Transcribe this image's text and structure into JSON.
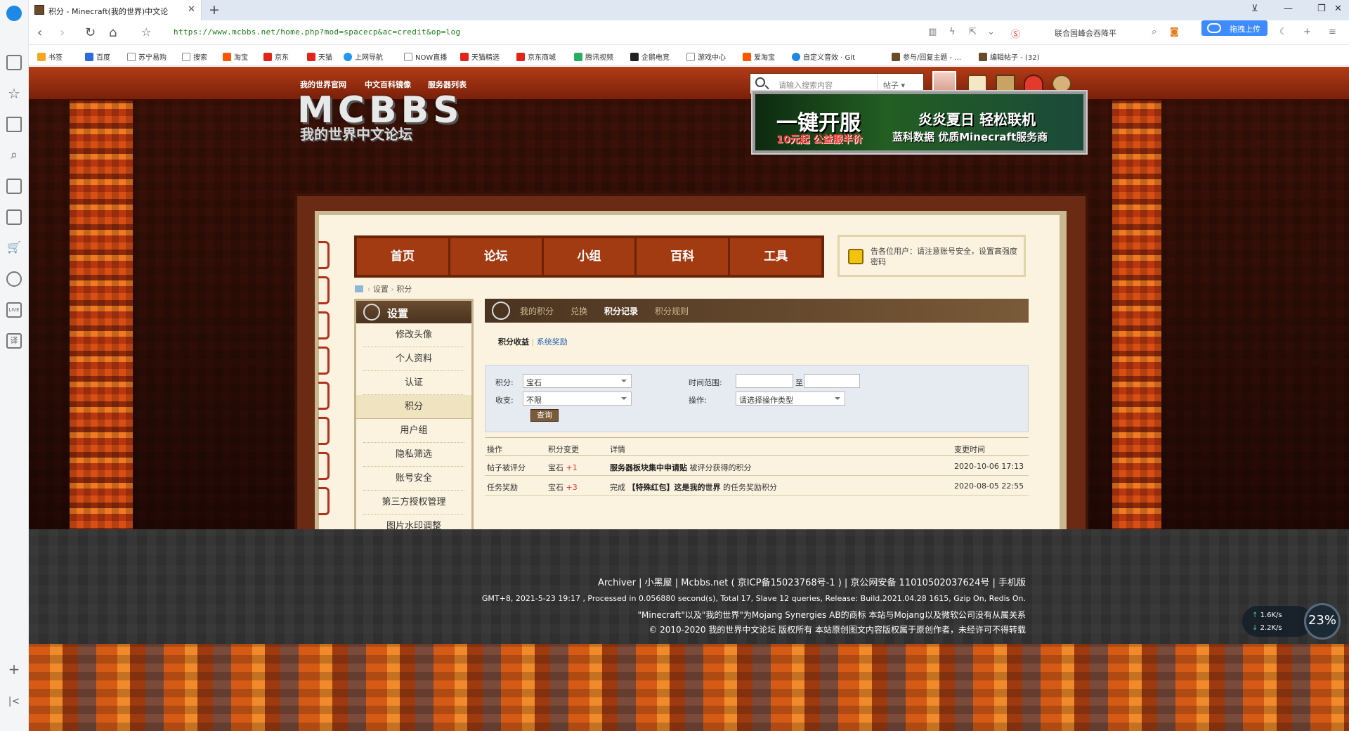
{
  "browser": {
    "tab_title": "积分 - Minecraft(我的世界)中文论",
    "url": "https://www.mcbbs.net/home.php?mod=spacecp&ac=credit&op=log",
    "search_hint": "联合国峰会吞降平",
    "upload_label": "拖拽上传",
    "bookmarks": [
      "书签",
      "百度",
      "苏宁易购",
      "搜索",
      "淘宝",
      "京东",
      "天猫",
      "上网导航",
      "NOW直播",
      "天猫精选",
      "京东商城",
      "腾讯视频",
      "企鹅电竞",
      "游戏中心",
      "爱淘宝",
      "自定义音效 · Git",
      "参与/回复主题 - ...",
      "编辑帖子 - (32)"
    ]
  },
  "site": {
    "top_links": [
      "我的世界官网",
      "中文百科镜像",
      "服务器列表"
    ],
    "search_placeholder": "请输入搜索内容",
    "search_type": "帖子",
    "logo_line1": "MCBBS",
    "logo_line2": "我的世界中文论坛",
    "banner": {
      "big": "一键开服",
      "promo": "10元起 公益服半价",
      "slogan": "炎炎夏日 轻松联机",
      "vendor": "蓝科数据 优质Minecraft服务商"
    },
    "nav": [
      "首页",
      "论坛",
      "小组",
      "百科",
      "工具"
    ],
    "notice": "告各位用户：请注意账号安全，设置高强度密码",
    "breadcrumb": [
      "设置",
      "积分"
    ]
  },
  "sidebar": {
    "title": "设置",
    "items": [
      "修改头像",
      "个人资料",
      "认证",
      "积分",
      "用户组",
      "隐私筛选",
      "账号安全",
      "第三方授权管理",
      "图片水印调整"
    ],
    "active": "积分"
  },
  "content": {
    "tabs": [
      "我的积分",
      "兑换",
      "积分记录",
      "积分规则"
    ],
    "active_tab": "积分记录",
    "subtabs": [
      "积分收益",
      "系统奖励"
    ],
    "filter": {
      "credit_label": "积分:",
      "credit_value": "宝石",
      "inout_label": "收支:",
      "inout_value": "不限",
      "time_label": "时间范围:",
      "to_label": "至",
      "op_label": "操作:",
      "op_value": "请选择操作类型",
      "query_button": "查询"
    },
    "table": {
      "headers": [
        "操作",
        "积分变更",
        "详情",
        "变更时间"
      ],
      "rows": [
        {
          "op": "帖子被评分",
          "credit": "宝石",
          "delta": "+1",
          "detail_bold": "服务器板块集中申请贴",
          "detail_rest": " 被评分获得的积分",
          "time": "2020-10-06 17:13"
        },
        {
          "op": "任务奖励",
          "credit": "宝石",
          "delta": "+3",
          "detail_pre": "完成 ",
          "detail_bold": "【特殊红包】这是我的世界",
          "detail_rest": " 的任务奖励积分",
          "time": "2020-08-05 22:55"
        }
      ]
    }
  },
  "footer": {
    "line1": "Archiver | 小黑屋 | Mcbbs.net ( 京ICP备15023768号-1 ) | 京公网安备 11010502037624号 | 手机版",
    "line2": "GMT+8, 2021-5-23 19:17 , Processed in 0.056880 second(s), Total 17, Slave 12 queries, Release: Build.2021.04.28 1615, Gzip On, Redis On.",
    "line3": "\"Minecraft\"以及\"我的世界\"为Mojang Synergies AB的商标 本站与Mojang以及微软公司没有从属关系",
    "line4": "© 2010-2020 我的世界中文论坛 版权所有 本站原创图文内容版权属于原创作者，未经许可不得转载"
  },
  "speed_widget": {
    "up": "1.6K/s",
    "down": "2.2K/s",
    "percent": "23%"
  }
}
